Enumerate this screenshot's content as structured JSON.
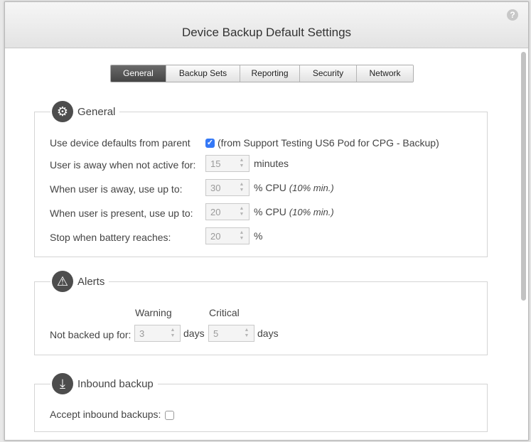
{
  "window": {
    "title": "Device Backup Default Settings"
  },
  "tabs": [
    {
      "label": "General",
      "active": true
    },
    {
      "label": "Backup Sets",
      "active": false
    },
    {
      "label": "Reporting",
      "active": false
    },
    {
      "label": "Security",
      "active": false
    },
    {
      "label": "Network",
      "active": false
    }
  ],
  "general": {
    "title": "General",
    "use_defaults_label": "Use device defaults from parent",
    "use_defaults_checked": true,
    "use_defaults_note": "(from Support Testing US6 Pod for CPG - Backup)",
    "away_label": "User is away when not active for:",
    "away_value": "15",
    "away_unit": "minutes",
    "away_cpu_label": "When user is away, use up to:",
    "away_cpu_value": "30",
    "present_cpu_label": "When user is present, use up to:",
    "present_cpu_value": "20",
    "cpu_unit": "% CPU",
    "cpu_min_note": "(10% min.)",
    "battery_label": "Stop when battery reaches:",
    "battery_value": "20",
    "battery_unit": "%"
  },
  "alerts": {
    "title": "Alerts",
    "warning_header": "Warning",
    "critical_header": "Critical",
    "not_backed_label": "Not backed up for:",
    "warning_value": "3",
    "critical_value": "5",
    "days_unit": "days"
  },
  "inbound": {
    "title": "Inbound backup",
    "accept_label": "Accept inbound backups:",
    "accept_checked": false
  },
  "icons": {
    "help": "question-mark-icon",
    "general": "gear-icon",
    "alerts": "warning-icon",
    "inbound": "download-tray-icon"
  },
  "colors": {
    "checkbox_accent": "#3478f6",
    "active_tab": "#4f4f4f",
    "section_icon_bg": "#4d4d4d"
  }
}
